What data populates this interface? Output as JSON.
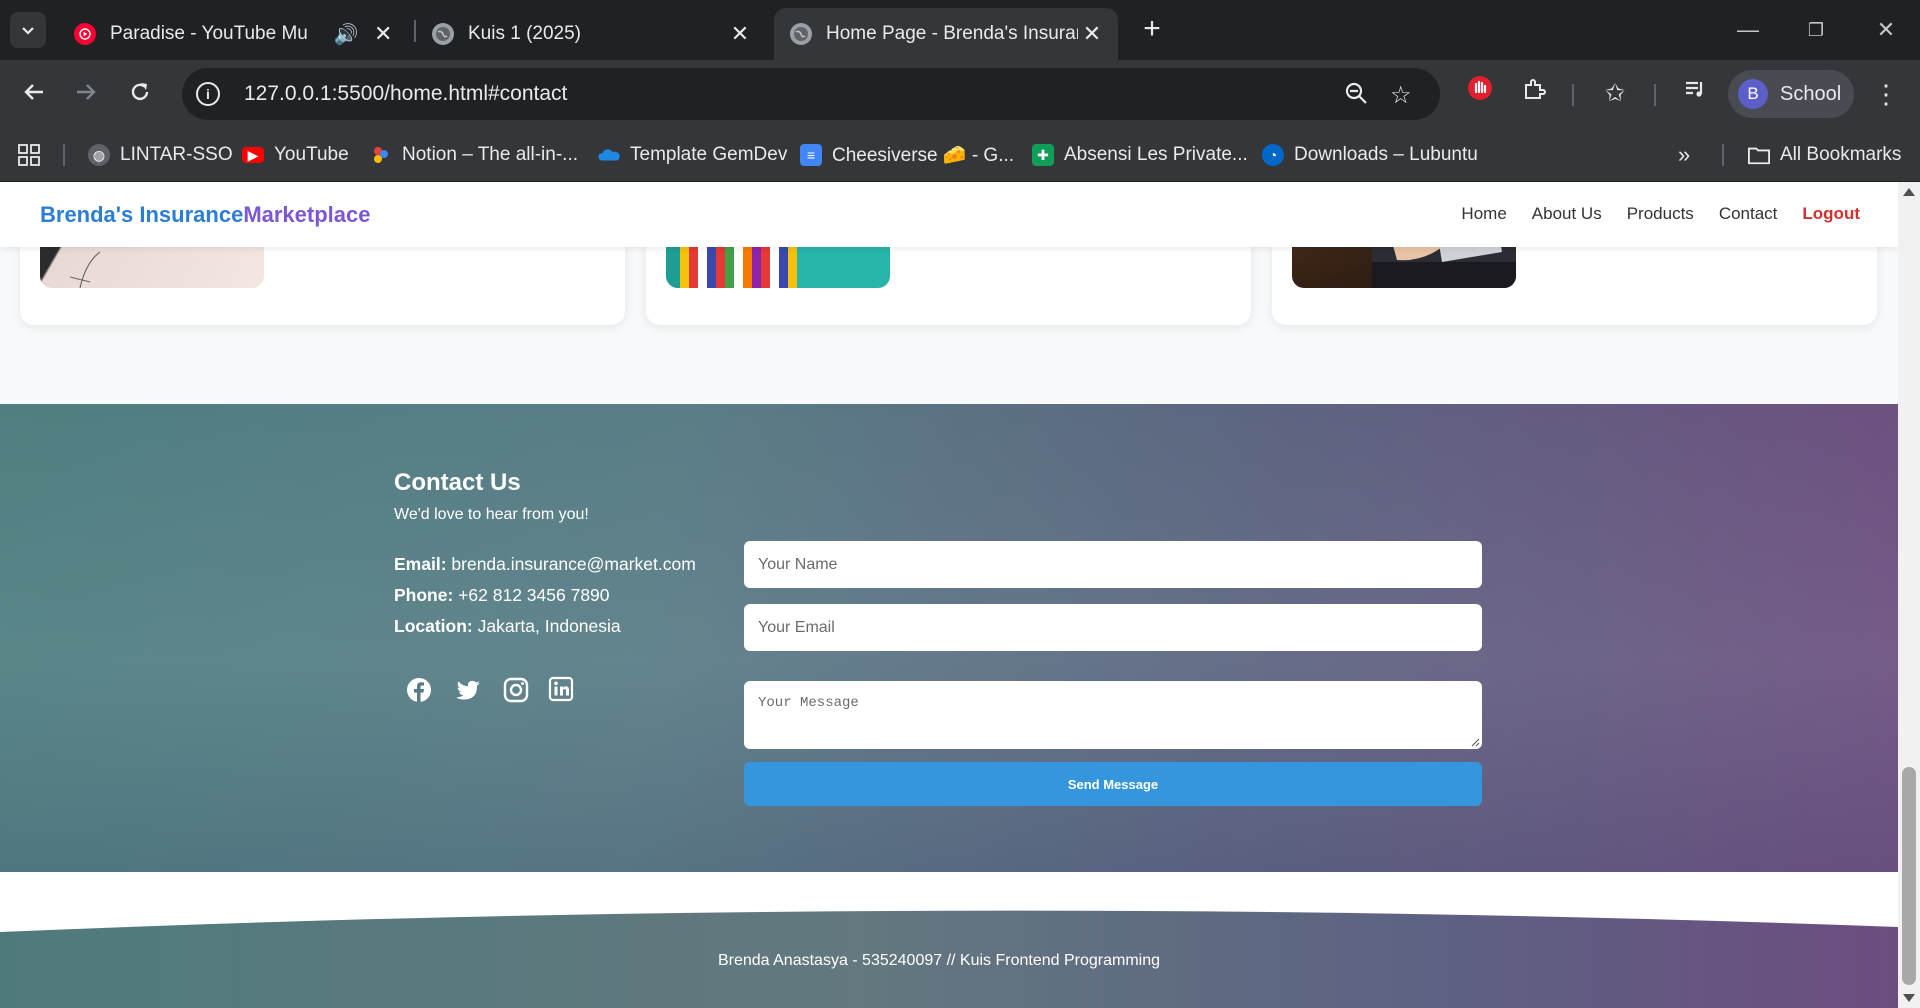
{
  "browser": {
    "tabs": [
      {
        "title": "Paradise - YouTube Music",
        "favicon": "youtube-music-icon",
        "audio": true
      },
      {
        "title": "Kuis 1 (2025)",
        "favicon": "globe-icon"
      },
      {
        "title": "Home Page - Brenda's Insurance",
        "favicon": "globe-icon",
        "active": true
      }
    ],
    "url": "127.0.0.1:5500/home.html#contact",
    "profile": {
      "initial": "B",
      "name": "School",
      "color": "#5b5fc7"
    },
    "bookmarks": [
      {
        "label": "LINTAR-SSO",
        "icon": "globe-icon"
      },
      {
        "label": "YouTube",
        "icon": "youtube-icon"
      },
      {
        "label": "Notion – The all-in-...",
        "icon": "notion-icon"
      },
      {
        "label": "Template GemDev",
        "icon": "onedrive-icon"
      },
      {
        "label": "Cheesiverse 🧀 - G...",
        "icon": "docs-icon"
      },
      {
        "label": "Absensi Les Private...",
        "icon": "sheets-icon"
      },
      {
        "label": "Downloads – Lubuntu",
        "icon": "lubuntu-icon"
      }
    ],
    "all_bookmarks": "All Bookmarks"
  },
  "site": {
    "brand_part1": "Brenda's Insurance",
    "brand_part2": "Marketplace",
    "nav": [
      "Home",
      "About Us",
      "Products",
      "Contact"
    ],
    "logout": "Logout",
    "colors": {
      "brand_blue": "#2b7dd6",
      "brand_purple": "#7b57d6",
      "logout_red": "#d32f2f",
      "button_blue": "#3596de"
    }
  },
  "contact": {
    "title": "Contact Us",
    "subtitle": "We'd love to hear from you!",
    "email_label": "Email:",
    "email_value": "brenda.insurance@market.com",
    "phone_label": "Phone:",
    "phone_value": "+62 812 3456 7890",
    "location_label": "Location:",
    "location_value": "Jakarta, Indonesia",
    "social": [
      "facebook-icon",
      "twitter-icon",
      "instagram-icon",
      "linkedin-icon"
    ],
    "form": {
      "name_placeholder": "Your Name",
      "email_placeholder": "Your Email",
      "message_placeholder": "Your Message",
      "submit": "Send Message"
    }
  },
  "footer": {
    "text": "Brenda Anastasya - 535240097 // Kuis Frontend Programming"
  }
}
